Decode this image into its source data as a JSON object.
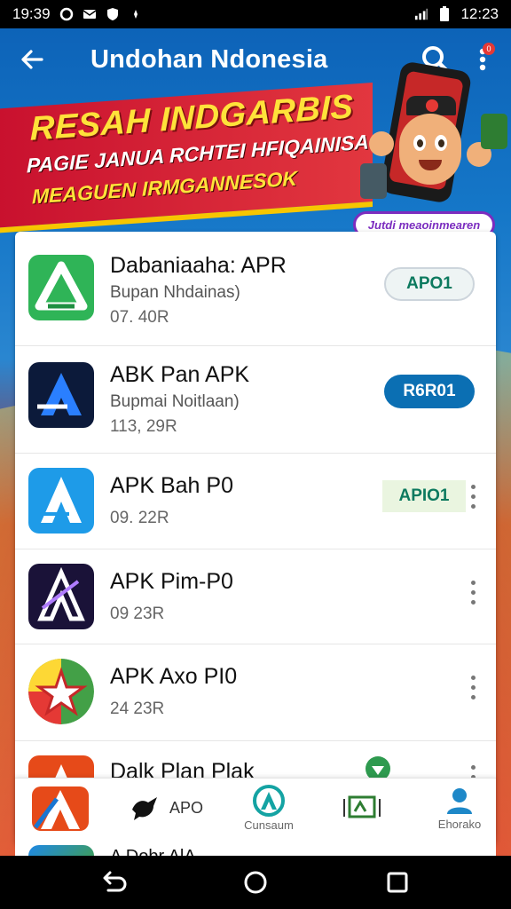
{
  "status_bar": {
    "time_left": "19:39",
    "time_right": "12:23",
    "icons": [
      "o-icon",
      "mail-icon",
      "shield-icon",
      "dot-icon",
      "signal-icon",
      "battery-icon"
    ]
  },
  "app_bar": {
    "title": "Undohan Ndonesia",
    "icons": [
      "back-arrow-icon",
      "search-icon",
      "more-vert-icon"
    ],
    "notification_count": "0"
  },
  "banner": {
    "headline": "RESAH INDGARBIS",
    "subline": "PAGIE JANUA RCHTEI HFIQAINISA",
    "subline2": "MEAGUEN IRMGANNESOK",
    "promo_pill": "Jutdi meaoinmearen"
  },
  "apps": [
    {
      "name": "Dabaniaaha: APR",
      "developer": "Bupan Nhdainas)",
      "size": "07. 40R",
      "action": "APO1",
      "action_style": "outline",
      "icon": "green-triangle-icon"
    },
    {
      "name": "ABK Pan APK",
      "developer": "Bupmai Noitlaan)",
      "size": "113, 29R",
      "action": "R6R01",
      "action_style": "filled",
      "icon": "navy-a-icon"
    },
    {
      "name": "APK Bah P0",
      "developer": "",
      "size": "09. 22R",
      "action": "APIO1",
      "action_style": "flat",
      "icon": "blue-a-icon"
    },
    {
      "name": "APK Pim-P0",
      "developer": "",
      "size": "09 23R",
      "action": "",
      "action_style": "menu",
      "icon": "dark-a-icon"
    },
    {
      "name": "APK Axo PI0",
      "developer": "",
      "size": "24 23R",
      "action": "",
      "action_style": "menu",
      "icon": "colorful-star-icon"
    },
    {
      "name": "Dalk Plan Plak",
      "developer": "",
      "size": "",
      "action": "",
      "action_style": "menu",
      "icon": "red-a-icon"
    }
  ],
  "bottom_tabs": [
    {
      "label": "",
      "icon": "bird-icon",
      "text": "APO"
    },
    {
      "label": "Cunsaum",
      "icon": "a-circle-icon"
    },
    {
      "label": "",
      "icon": "tv-icon"
    },
    {
      "label": "Ehorako",
      "icon": "person-icon"
    }
  ],
  "peek_row": {
    "name": "A Dobr AlA"
  },
  "colors": {
    "header_blue": "#0d63b8",
    "accent_teal": "#0d7a5f",
    "primary_blue": "#0b6fb3",
    "banner_red": "#c8102e",
    "banner_yellow": "#ffe23a"
  }
}
